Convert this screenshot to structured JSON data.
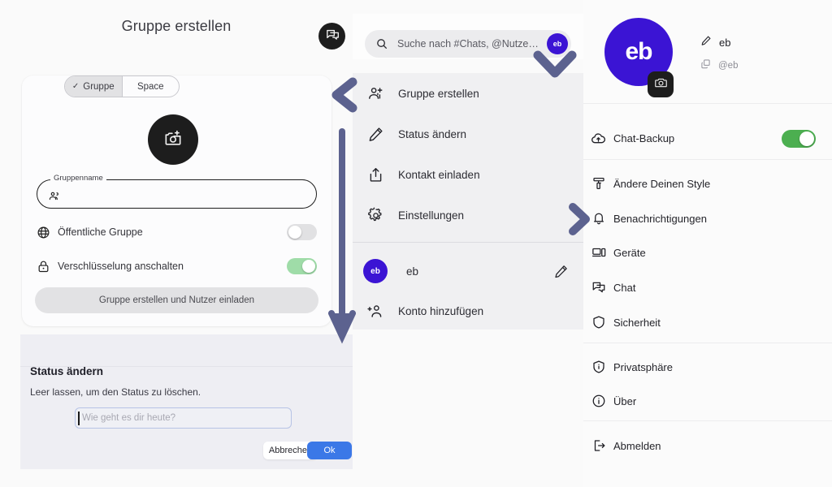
{
  "colors": {
    "accent_purple": "#3b14d4",
    "arrow_indigo": "#5c628f",
    "toggle_green": "#4caf50",
    "toggle_green_light": "#9fdca8",
    "primary_blue": "#3b78e7",
    "dark": "#1d1d1d"
  },
  "left_panel": {
    "title": "Gruppe erstellen",
    "segmented": {
      "options": [
        {
          "label": "Gruppe",
          "selected": true,
          "check": "✓"
        },
        {
          "label": "Space",
          "selected": false
        }
      ]
    },
    "avatar_icon": "add-photo-icon",
    "group_name_field": {
      "legend": "Gruppenname",
      "value": "",
      "placeholder": "",
      "icon": "group-icon"
    },
    "options": [
      {
        "icon": "globe-icon",
        "label": "Öffentliche Gruppe",
        "toggle_on": false
      },
      {
        "icon": "lock-icon",
        "label": "Verschlüsselung anschalten",
        "toggle_on": true
      }
    ],
    "cta_label": "Gruppe erstellen und Nutzer einladen"
  },
  "status_dialog": {
    "title": "Status ändern",
    "subtitle": "Leer lassen, um den Status zu löschen.",
    "input_value": "",
    "input_placeholder": "Wie geht es dir heute?",
    "cancel_label": "Abbrechen",
    "ok_label": "Ok"
  },
  "center_panel": {
    "logo_icon": "chat-bubble-icon",
    "search": {
      "icon": "search-icon",
      "placeholder": "Suche nach #Chats, @Nutze…",
      "value": "",
      "avatar_initials": "eb"
    },
    "menu_items": [
      {
        "icon": "add-group-icon",
        "label": "Gruppe erstellen"
      },
      {
        "icon": "pencil-icon",
        "label": "Status ändern"
      },
      {
        "icon": "share-icon",
        "label": "Kontakt einladen"
      },
      {
        "icon": "gear-icon",
        "label": "Einstellungen"
      }
    ],
    "account": {
      "initials": "eb",
      "name": "eb",
      "edit_icon": "pencil-icon"
    },
    "add_account": {
      "icon": "add-person-icon",
      "label": "Konto hinzufügen"
    }
  },
  "right_panel": {
    "profile": {
      "initials": "eb",
      "camera_icon": "camera-icon",
      "name": "eb",
      "name_icon": "pencil-icon",
      "handle": "@eb",
      "handle_icon": "copy-icon"
    },
    "backup": {
      "icon": "cloud-upload-icon",
      "label": "Chat-Backup",
      "toggle_on": true
    },
    "nav_groups": [
      [
        {
          "icon": "paint-roller-icon",
          "label": "Ändere Deinen Style"
        },
        {
          "icon": "bell-icon",
          "label": "Benachrichtigungen"
        },
        {
          "icon": "devices-icon",
          "label": "Geräte"
        },
        {
          "icon": "chat-icon",
          "label": "Chat"
        },
        {
          "icon": "shield-icon",
          "label": "Sicherheit"
        }
      ],
      [
        {
          "icon": "privacy-shield-icon",
          "label": "Privatsphäre"
        },
        {
          "icon": "info-icon",
          "label": "Über"
        }
      ],
      [
        {
          "icon": "logout-icon",
          "label": "Abmelden"
        }
      ]
    ],
    "watermark": "eb"
  }
}
